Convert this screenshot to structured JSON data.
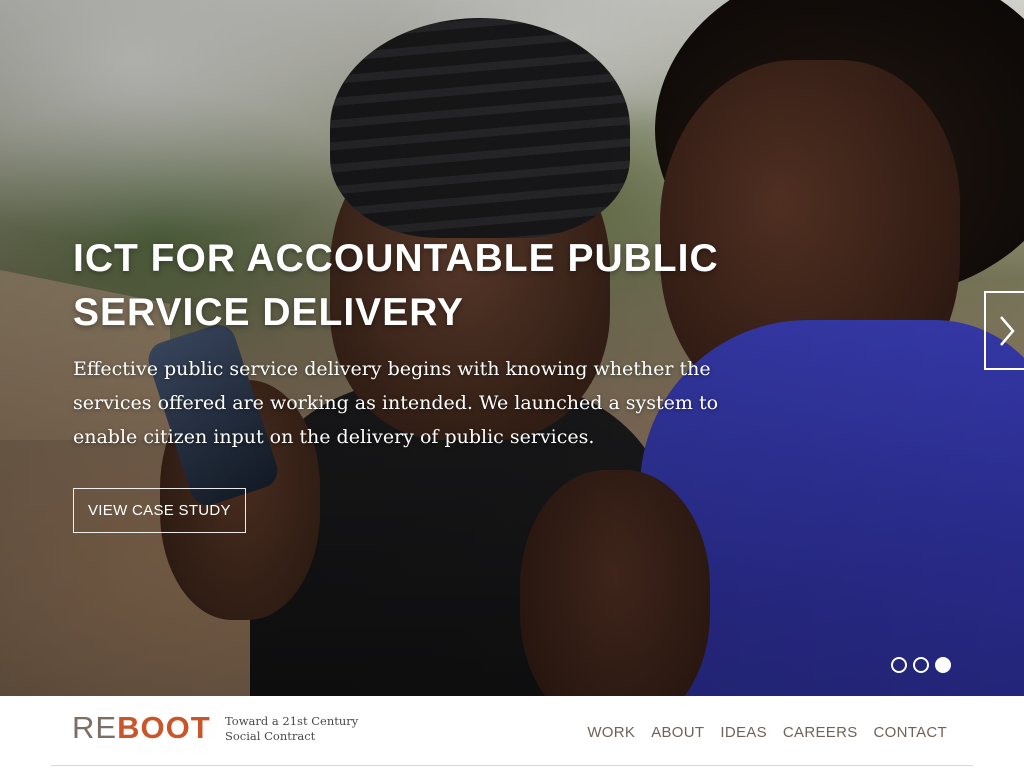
{
  "hero": {
    "title_line1": "ICT FOR ACCOUNTABLE PUBLIC",
    "title_line2": "SERVICE DELIVERY",
    "description": "Effective public service delivery begins with knowing whether the services offered are working as intended. We launched a system to enable citizen input on the delivery of public services.",
    "cta_label": "VIEW CASE STUDY",
    "next_icon": "chevron-right-icon",
    "slides_total": 3,
    "active_slide": 3
  },
  "header": {
    "logo": {
      "part1": "RE",
      "part2": "BOOT",
      "color_re": "#7d6e63",
      "color_boot": "#c8562a"
    },
    "tagline_line1": "Toward a 21st Century",
    "tagline_line2": "Social Contract",
    "nav": [
      {
        "label": "WORK"
      },
      {
        "label": "ABOUT"
      },
      {
        "label": "IDEAS"
      },
      {
        "label": "CAREERS"
      },
      {
        "label": "CONTACT"
      }
    ]
  },
  "colors": {
    "accent": "#c8562a",
    "nav_text": "#6f6258",
    "hero_text": "#ffffff"
  }
}
